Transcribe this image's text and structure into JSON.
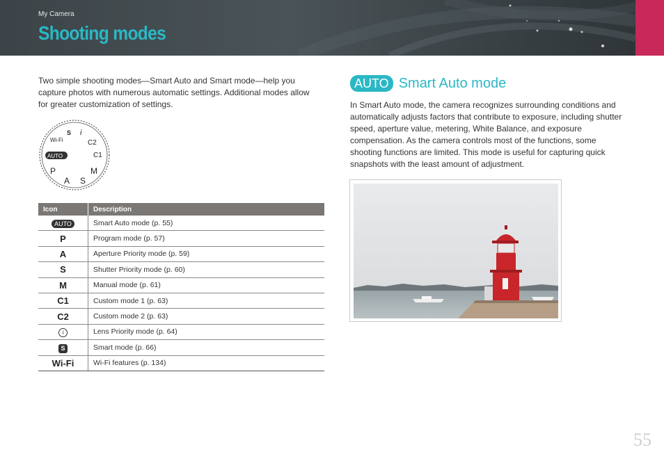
{
  "header": {
    "breadcrumb": "My Camera",
    "title": "Shooting modes",
    "colors": {
      "title": "#2bb8c5",
      "header_bg": "#3c4448",
      "tab": "#c8285a"
    }
  },
  "intro": "Two simple shooting modes—Smart Auto and Smart mode—help you capture photos with numerous automatic settings. Additional modes allow for greater customization of settings.",
  "dial": {
    "labels": {
      "auto": "AUTO",
      "p": "P",
      "a": "A",
      "s": "S",
      "m": "M",
      "c2": "C2",
      "c1": "C1",
      "i": "i",
      "smart": "S",
      "wifi": "Wi-Fi"
    }
  },
  "table": {
    "headers": {
      "icon": "Icon",
      "description": "Description"
    },
    "rows": [
      {
        "icon": "AUTO",
        "description": "Smart Auto mode (p. 55)"
      },
      {
        "icon": "P",
        "description": "Program mode (p. 57)"
      },
      {
        "icon": "A",
        "description": "Aperture Priority mode (p. 59)"
      },
      {
        "icon": "S",
        "description": "Shutter Priority mode (p. 60)"
      },
      {
        "icon": "M",
        "description": "Manual mode (p. 61)"
      },
      {
        "icon": "C1",
        "description": "Custom mode 1 (p. 63)"
      },
      {
        "icon": "C2",
        "description": "Custom mode 2 (p. 63)"
      },
      {
        "icon": "i",
        "description": "Lens Priority mode (p. 64)"
      },
      {
        "icon": "S",
        "description": "Smart mode (p. 66)"
      },
      {
        "icon": "Wi-Fi",
        "description": "Wi-Fi features (p. 134)"
      }
    ]
  },
  "section": {
    "badge": "AUTO",
    "title": "Smart Auto mode",
    "body": "In Smart Auto mode, the camera recognizes surrounding conditions and automatically adjusts factors that contribute to exposure, including shutter speed, aperture value, metering, White Balance, and exposure compensation. As the camera controls most of the functions, some shooting functions are limited. This mode is useful for capturing quick snapshots with the least amount of adjustment."
  },
  "page_number": "55"
}
